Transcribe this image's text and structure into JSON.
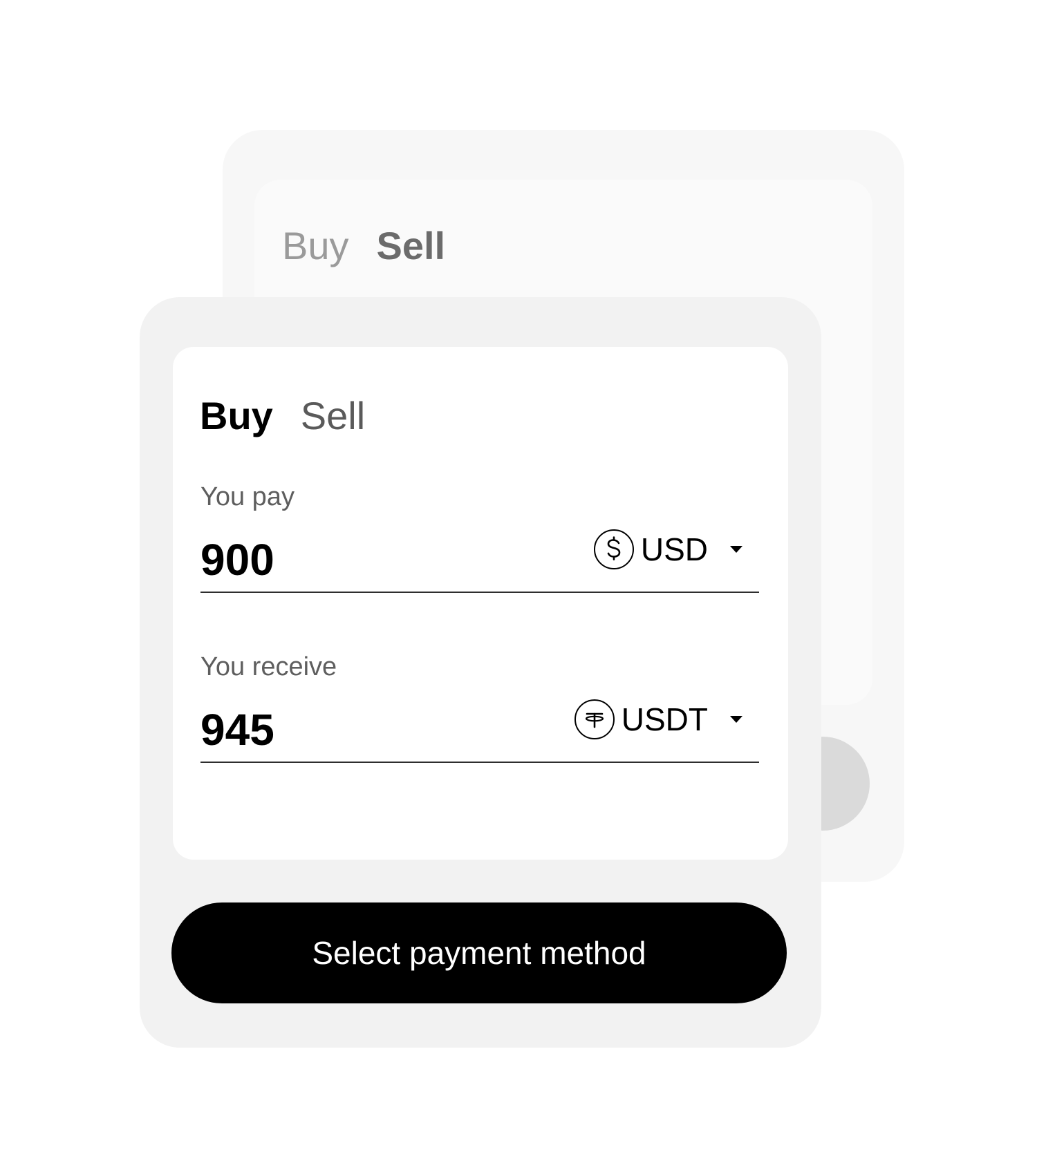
{
  "back_card": {
    "tabs": [
      {
        "label": "Buy",
        "active": false
      },
      {
        "label": "Sell",
        "active": true
      }
    ]
  },
  "front_card": {
    "tabs": [
      {
        "label": "Buy",
        "active": true
      },
      {
        "label": "Sell",
        "active": false
      }
    ],
    "pay": {
      "label": "You pay",
      "amount": "900",
      "currency": "USD",
      "currency_icon": "dollar-coin-icon"
    },
    "receive": {
      "label": "You receive",
      "amount": "945",
      "currency": "USDT",
      "currency_icon": "tether-coin-icon"
    },
    "button_label": "Select payment method"
  },
  "colors": {
    "button_bg": "#000000",
    "card_bg": "#f2f2f2",
    "inactive_tab": "#5a5a5a"
  }
}
